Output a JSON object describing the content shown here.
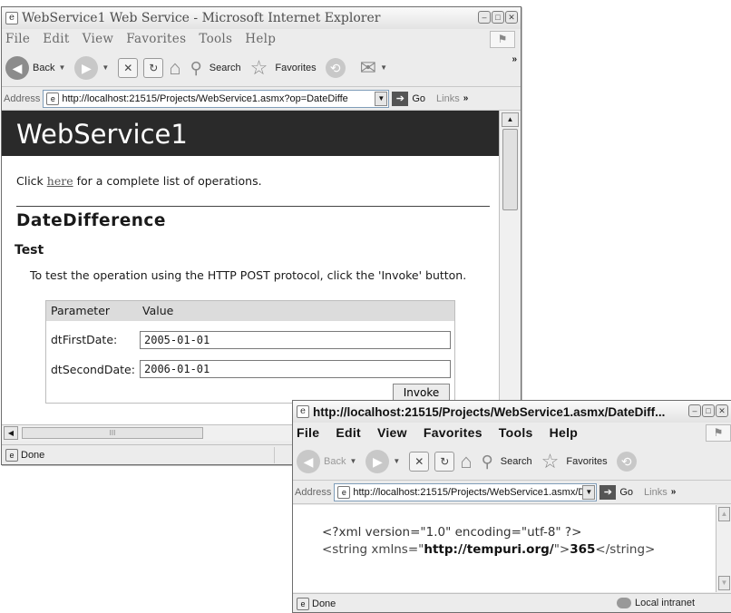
{
  "window1": {
    "title": "WebService1 Web Service - Microsoft Internet Explorer",
    "menu": [
      "File",
      "Edit",
      "View",
      "Favorites",
      "Tools",
      "Help"
    ],
    "toolbar": {
      "back": "Back",
      "search": "Search",
      "favorites": "Favorites"
    },
    "address": {
      "label": "Address",
      "url": "http://localhost:21515/Projects/WebService1.asmx?op=DateDiffe",
      "go": "Go",
      "links": "Links"
    },
    "page": {
      "header": "WebService1",
      "intro_before": "Click ",
      "intro_link": "here",
      "intro_after": " for a complete list of operations.",
      "operation": "DateDifference",
      "section": "Test",
      "instruction": "To test the operation using the HTTP POST protocol, click the 'Invoke' button.",
      "table": {
        "col_parameter": "Parameter",
        "col_value": "Value",
        "rows": [
          {
            "label": "dtFirstDate:",
            "value": "2005-01-01"
          },
          {
            "label": "dtSecondDate:",
            "value": "2006-01-01"
          }
        ],
        "invoke_label": "Invoke"
      }
    },
    "status": "Done"
  },
  "window2": {
    "title": "http://localhost:21515/Projects/WebService1.asmx/DateDiff...",
    "menu": [
      "File",
      "Edit",
      "View",
      "Favorites",
      "Tools",
      "Help"
    ],
    "toolbar": {
      "back": "Back",
      "search": "Search",
      "favorites": "Favorites"
    },
    "address": {
      "label": "Address",
      "url": "http://localhost:21515/Projects/WebService1.asmx/D",
      "go": "Go",
      "links": "Links"
    },
    "xml": {
      "declaration": "<?xml version=\"1.0\" encoding=\"utf-8\" ?>",
      "open_tag": "<string xmlns=\"",
      "namespace": "http://tempuri.org/",
      "open_tag_end": "\">",
      "result": "365",
      "close_tag": "</string>"
    },
    "status": "Done",
    "zone": "Local intranet"
  }
}
